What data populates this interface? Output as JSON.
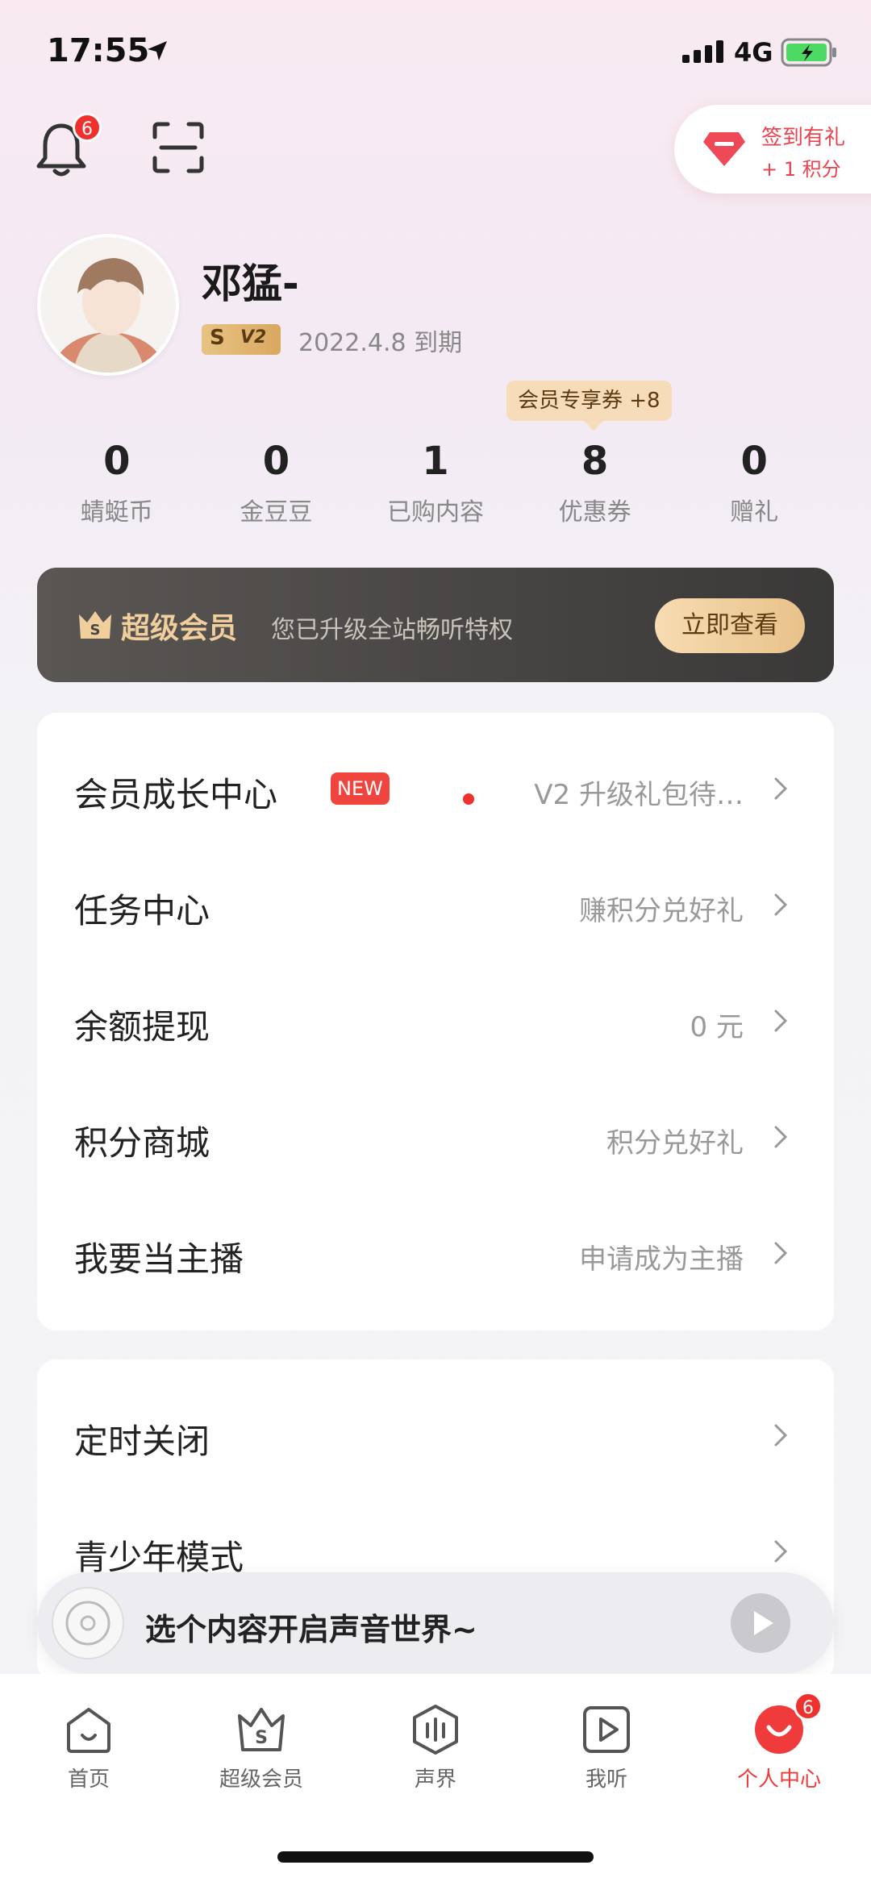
{
  "status_bar": {
    "time": "17:55",
    "network": "4G"
  },
  "header": {
    "notification_badge": "6",
    "checkin": {
      "title": "签到有礼",
      "subtitle": "+ 1 积分"
    }
  },
  "profile": {
    "name": "邓猛-",
    "vip_letter": "S",
    "vip_level": "V2",
    "expire": "2022.4.8 到期",
    "coupon_tip": "会员专享券 +8"
  },
  "stats": [
    {
      "value": "0",
      "label": "蜻蜓币"
    },
    {
      "value": "0",
      "label": "金豆豆"
    },
    {
      "value": "1",
      "label": "已购内容"
    },
    {
      "value": "8",
      "label": "优惠券"
    },
    {
      "value": "0",
      "label": "赠礼"
    }
  ],
  "super_member": {
    "title": "超级会员",
    "desc": "您已升级全站畅听特权",
    "button": "立即查看"
  },
  "menu1": [
    {
      "label": "会员成长中心",
      "badge": "NEW",
      "value": "V2 升级礼包待…"
    },
    {
      "label": "任务中心",
      "value": "赚积分兑好礼"
    },
    {
      "label": "余额提现",
      "value": "0 元"
    },
    {
      "label": "积分商城",
      "value": "积分兑好礼"
    },
    {
      "label": "我要当主播",
      "value": "申请成为主播"
    }
  ],
  "menu2": [
    {
      "label": "定时关闭"
    },
    {
      "label": "青少年模式"
    }
  ],
  "player": {
    "text": "选个内容开启声音世界~"
  },
  "tabs": [
    {
      "label": "首页",
      "icon": "home-icon"
    },
    {
      "label": "超级会员",
      "icon": "vip-crown-icon"
    },
    {
      "label": "声界",
      "icon": "sound-icon"
    },
    {
      "label": "我听",
      "icon": "play-list-icon"
    },
    {
      "label": "个人中心",
      "icon": "profile-icon",
      "badge": "6",
      "active": true
    }
  ],
  "colors": {
    "accent_red": "#ef3b3b",
    "gold": "#f0cf9d",
    "badge_red": "#f0302d"
  }
}
